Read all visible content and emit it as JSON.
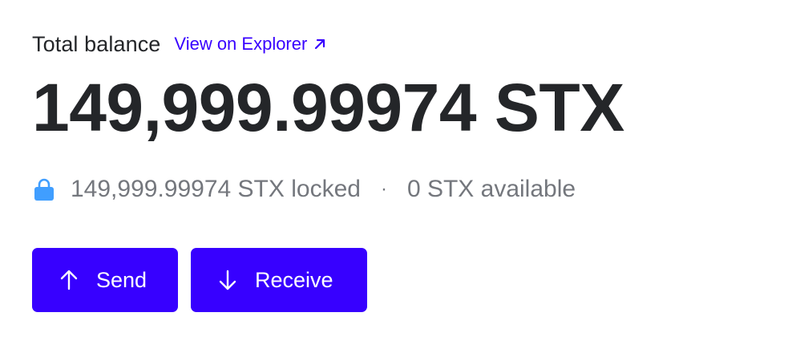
{
  "balance_card": {
    "total_label": "Total balance",
    "explorer_link_label": "View on Explorer",
    "amount": "149,999.99974 STX",
    "locked_text": "149,999.99974 STX locked",
    "separator": "·",
    "available_text": "0 STX available",
    "actions": {
      "send_label": "Send",
      "receive_label": "Receive"
    }
  },
  "colors": {
    "accent": "#3700ff",
    "text_primary": "#242629",
    "text_secondary": "#74777d",
    "lock_icon": "#409eff"
  },
  "icons": {
    "explorer": "arrow-up-right-icon",
    "locked": "lock-icon",
    "send": "arrow-up-icon",
    "receive": "arrow-down-icon"
  }
}
